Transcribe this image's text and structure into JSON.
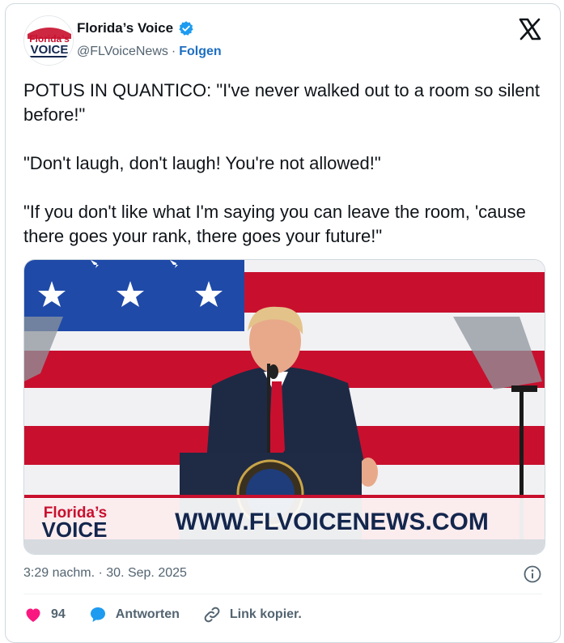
{
  "account": {
    "display_name": "Florida’s Voice",
    "handle": "@FLVoiceNews",
    "separator": "·",
    "follow_label": "Folgen",
    "avatar_line1": "Florida’s",
    "avatar_line2": "VOICE"
  },
  "tweet": {
    "text": "POTUS IN QUANTICO: \"I've never walked out to a room so silent before!\"\n\n\"Don't laugh, don't laugh! You're not allowed!\"\n\n\"If you don't like what I'm saying you can leave the room, 'cause there goes your rank, there goes your future!\"",
    "timestamp": "3:29 nachm. · 30. Sep. 2025"
  },
  "media": {
    "banner_logo_line1": "Florida’s",
    "banner_logo_line2": "VOICE",
    "banner_url": "WWW.FLVOICENEWS.COM"
  },
  "actions": {
    "like_count": "94",
    "reply_label": "Antworten",
    "copy_link_label": "Link kopier."
  },
  "colors": {
    "verified": "#1d9bf0",
    "like": "#f91880",
    "reply": "#1d9bf0",
    "flag_blue": "#1f4aa8",
    "flag_red": "#c8102e",
    "brand_red": "#c8102e",
    "brand_navy": "#13264d"
  },
  "icons": {
    "verified": "verified-badge-icon",
    "x": "x-logo-icon",
    "info": "info-icon",
    "like": "heart-icon",
    "reply": "speech-bubble-icon",
    "link": "link-icon"
  }
}
